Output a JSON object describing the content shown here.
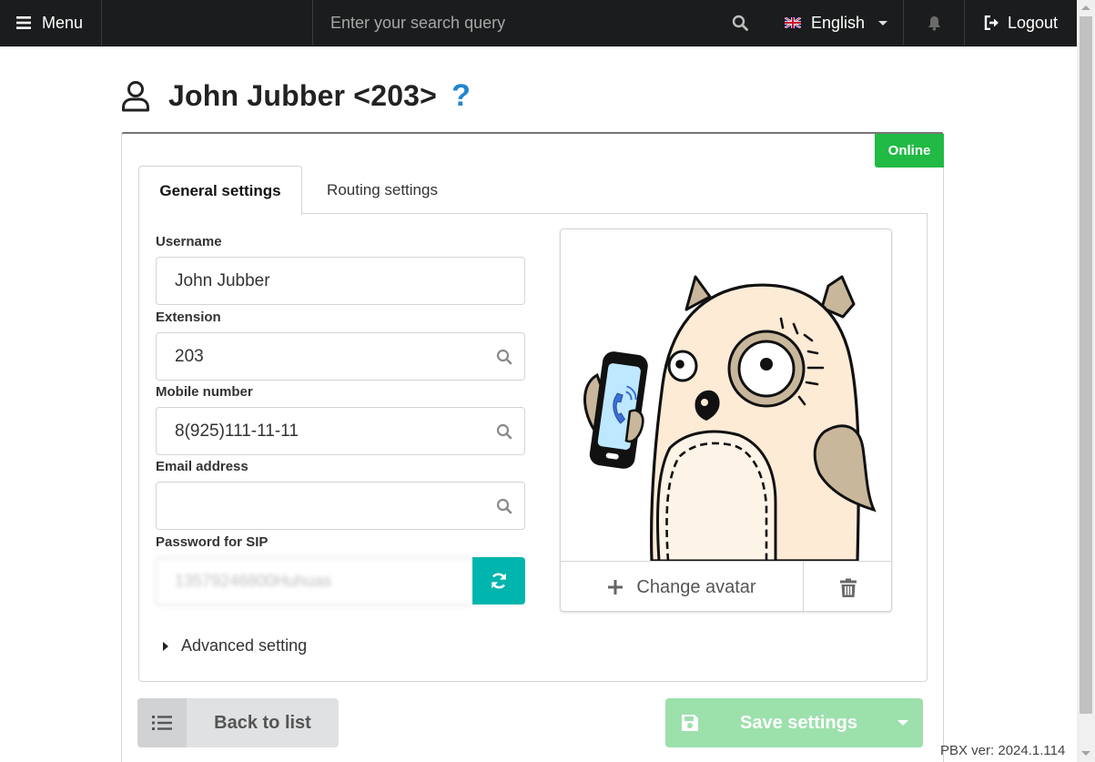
{
  "topbar": {
    "menu_label": "Menu",
    "search_placeholder": "Enter your search query",
    "language_label": "English",
    "logout_label": "Logout"
  },
  "header": {
    "title": "John Jubber <203>",
    "help_glyph": "?"
  },
  "status": {
    "label": "Online",
    "color": "#21ba45"
  },
  "tabs": [
    {
      "label": "General settings",
      "active": true
    },
    {
      "label": "Routing settings",
      "active": false
    }
  ],
  "form": {
    "username": {
      "label": "Username",
      "value": "John Jubber"
    },
    "extension": {
      "label": "Extension",
      "value": "203"
    },
    "mobile": {
      "label": "Mobile number",
      "value": "8(925)111-11-11"
    },
    "email": {
      "label": "Email address",
      "value": ""
    },
    "sip_password": {
      "label": "Password for SIP",
      "value": "13579246800Huhuas"
    }
  },
  "advanced_label": "Advanced setting",
  "avatar": {
    "change_label": "Change avatar"
  },
  "buttons": {
    "back_label": "Back to list",
    "save_label": "Save settings"
  },
  "footer": {
    "version": "PBX ver: 2024.1.114"
  },
  "icons": {
    "menu": "hamburger-icon",
    "search": "search-icon",
    "flag": "uk-flag-icon",
    "bell": "bell-icon",
    "logout": "sign-out-icon",
    "user": "user-outline-icon",
    "refresh": "refresh-icon",
    "plus": "plus-icon",
    "trash": "trash-icon",
    "list": "list-icon",
    "save": "save-icon"
  },
  "colors": {
    "topbar": "#1b1c1d",
    "accent_teal": "#00b5ad",
    "help_blue": "#2185d0",
    "save_green_disabled": "#9ce0ac"
  }
}
